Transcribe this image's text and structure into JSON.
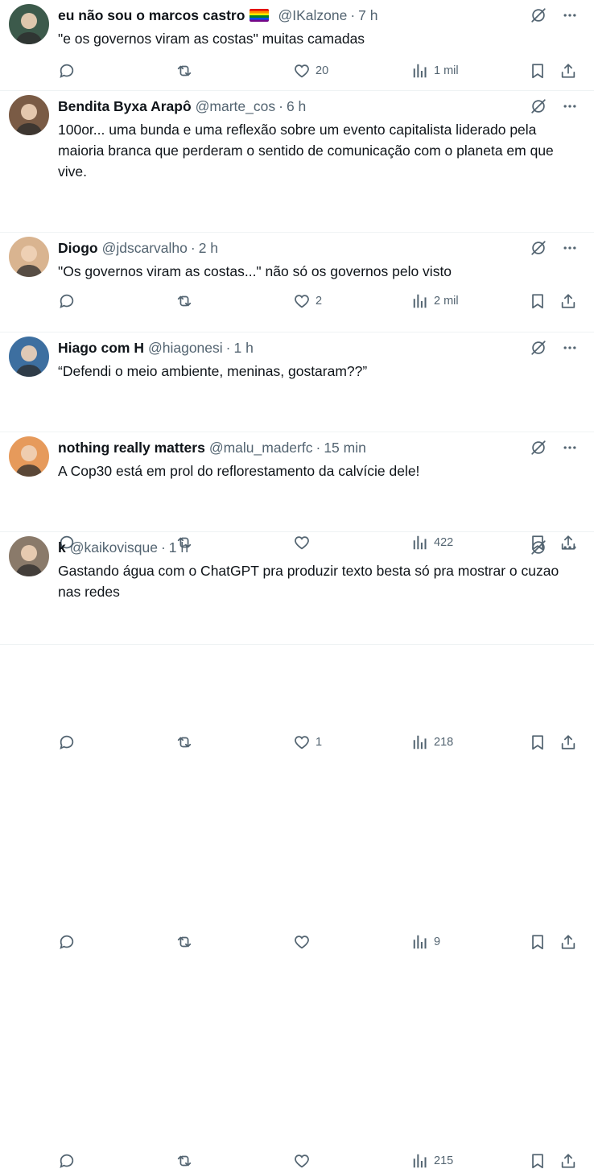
{
  "tweets": [
    {
      "name": "eu não sou o marcos castro",
      "flag": true,
      "handle": "@IKalzone",
      "time": "7 h",
      "text": "\"e os governos viram as costas\" muitas camadas",
      "likes": "20",
      "views": "1 mil",
      "avatar_color": "#3c5a4b"
    },
    {
      "name": "Bendita Byxa Arapô",
      "flag": false,
      "handle": "@marte_cos",
      "time": "6 h",
      "text": "100or... uma bunda e uma reflexão sobre um evento capitalista liderado pela maioria branca que perderam o sentido de comunicação com o planeta em que vive.",
      "likes": "2",
      "views": "2 mil",
      "avatar_color": "#7a5b45"
    },
    {
      "name": "Diogo",
      "flag": false,
      "handle": "@jdscarvalho",
      "time": "2 h",
      "text": "\"Os governos viram as costas...\" não só os governos pelo visto",
      "likes": "",
      "views": "422",
      "avatar_color": "#d9b490"
    },
    {
      "name": "Hiago com H",
      "flag": false,
      "handle": "@hiagonesi",
      "time": "1 h",
      "text": "“Defendi o meio ambiente, meninas, gostaram??”",
      "likes": "1",
      "views": "218",
      "avatar_color": "#3d6fa0"
    },
    {
      "name": "nothing really matters",
      "flag": false,
      "handle": "@malu_maderfc",
      "time": "15 min",
      "text": "A Cop30 está em prol do reflorestamento da calvície dele!",
      "likes": "",
      "views": "9",
      "avatar_color": "#e69a5b"
    },
    {
      "name": "k",
      "flag": false,
      "handle": "@kaikovisque",
      "time": "1 h",
      "text": "Gastando água com o ChatGPT pra produzir texto besta só pra mostrar o cuzao nas redes",
      "likes": "",
      "views": "215",
      "avatar_color": "#8a7a6a"
    }
  ],
  "icons": {
    "reply": "reply-icon",
    "retweet": "retweet-icon",
    "like": "heart-icon",
    "views": "views-icon",
    "bookmark": "bookmark-icon",
    "share": "share-icon",
    "grok": "grok-icon",
    "more": "more-icon"
  },
  "colors": {
    "text": "#0f1419",
    "secondary": "#536471",
    "divider": "#eff3f4"
  }
}
